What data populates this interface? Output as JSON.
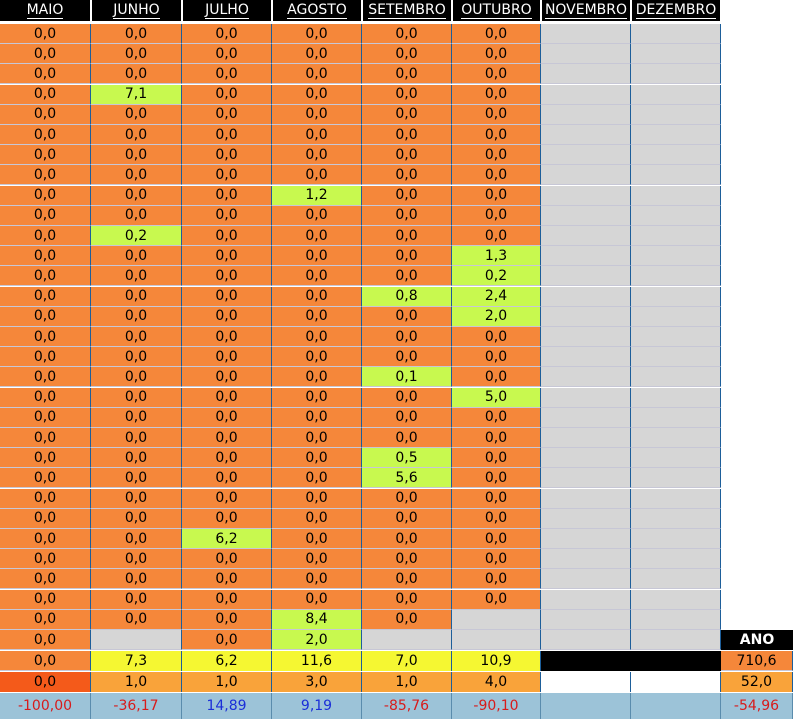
{
  "headers": [
    "MAIO",
    "JUNHO",
    "JULHO",
    "AGOSTO",
    "SETEMBRO",
    "OUTUBRO",
    "NOVEMBRO",
    "DEZEMBRO"
  ],
  "rows": [
    [
      "0,0",
      "0,0",
      "0,0",
      "0,0",
      "0,0",
      "0,0"
    ],
    [
      "0,0",
      "0,0",
      "0,0",
      "0,0",
      "0,0",
      "0,0"
    ],
    [
      "0,0",
      "0,0",
      "0,0",
      "0,0",
      "0,0",
      "0,0"
    ],
    [
      "0,0",
      "7,1",
      "0,0",
      "0,0",
      "0,0",
      "0,0"
    ],
    [
      "0,0",
      "0,0",
      "0,0",
      "0,0",
      "0,0",
      "0,0"
    ],
    [
      "0,0",
      "0,0",
      "0,0",
      "0,0",
      "0,0",
      "0,0"
    ],
    [
      "0,0",
      "0,0",
      "0,0",
      "0,0",
      "0,0",
      "0,0"
    ],
    [
      "0,0",
      "0,0",
      "0,0",
      "0,0",
      "0,0",
      "0,0"
    ],
    [
      "0,0",
      "0,0",
      "0,0",
      "1,2",
      "0,0",
      "0,0"
    ],
    [
      "0,0",
      "0,0",
      "0,0",
      "0,0",
      "0,0",
      "0,0"
    ],
    [
      "0,0",
      "0,2",
      "0,0",
      "0,0",
      "0,0",
      "0,0"
    ],
    [
      "0,0",
      "0,0",
      "0,0",
      "0,0",
      "0,0",
      "1,3"
    ],
    [
      "0,0",
      "0,0",
      "0,0",
      "0,0",
      "0,0",
      "0,2"
    ],
    [
      "0,0",
      "0,0",
      "0,0",
      "0,0",
      "0,8",
      "2,4"
    ],
    [
      "0,0",
      "0,0",
      "0,0",
      "0,0",
      "0,0",
      "2,0"
    ],
    [
      "0,0",
      "0,0",
      "0,0",
      "0,0",
      "0,0",
      "0,0"
    ],
    [
      "0,0",
      "0,0",
      "0,0",
      "0,0",
      "0,0",
      "0,0"
    ],
    [
      "0,0",
      "0,0",
      "0,0",
      "0,0",
      "0,1",
      "0,0"
    ],
    [
      "0,0",
      "0,0",
      "0,0",
      "0,0",
      "0,0",
      "5,0"
    ],
    [
      "0,0",
      "0,0",
      "0,0",
      "0,0",
      "0,0",
      "0,0"
    ],
    [
      "0,0",
      "0,0",
      "0,0",
      "0,0",
      "0,0",
      "0,0"
    ],
    [
      "0,0",
      "0,0",
      "0,0",
      "0,0",
      "0,5",
      "0,0"
    ],
    [
      "0,0",
      "0,0",
      "0,0",
      "0,0",
      "5,6",
      "0,0"
    ],
    [
      "0,0",
      "0,0",
      "0,0",
      "0,0",
      "0,0",
      "0,0"
    ],
    [
      "0,0",
      "0,0",
      "0,0",
      "0,0",
      "0,0",
      "0,0"
    ],
    [
      "0,0",
      "0,0",
      "6,2",
      "0,0",
      "0,0",
      "0,0"
    ],
    [
      "0,0",
      "0,0",
      "0,0",
      "0,0",
      "0,0",
      "0,0"
    ],
    [
      "0,0",
      "0,0",
      "0,0",
      "0,0",
      "0,0",
      "0,0"
    ],
    [
      "0,0",
      "0,0",
      "0,0",
      "0,0",
      "0,0",
      "0,0"
    ],
    [
      "0,0",
      "0,0",
      "0,0",
      "8,4",
      "0,0",
      ""
    ],
    [
      "0,0",
      "",
      "0,0",
      "2,0",
      "",
      ""
    ]
  ],
  "ano_label": "ANO",
  "totals": [
    "0,0",
    "7,3",
    "6,2",
    "11,6",
    "7,0",
    "10,9",
    "",
    ""
  ],
  "totals_year": "710,6",
  "counts": [
    "0,0",
    "1,0",
    "1,0",
    "3,0",
    "1,0",
    "4,0",
    "",
    ""
  ],
  "counts_year": "52,0",
  "deviations": [
    "-100,00",
    "-36,17",
    "14,89",
    "9,19",
    "-85,76",
    "-90,10",
    "",
    ""
  ],
  "deviations_year": "-54,96",
  "colors": {
    "orange": "#f5873a",
    "green": "#c8f94f",
    "grey": "#d6d6d6",
    "yellow": "#f5f732",
    "blue": "#9cc3d8"
  }
}
